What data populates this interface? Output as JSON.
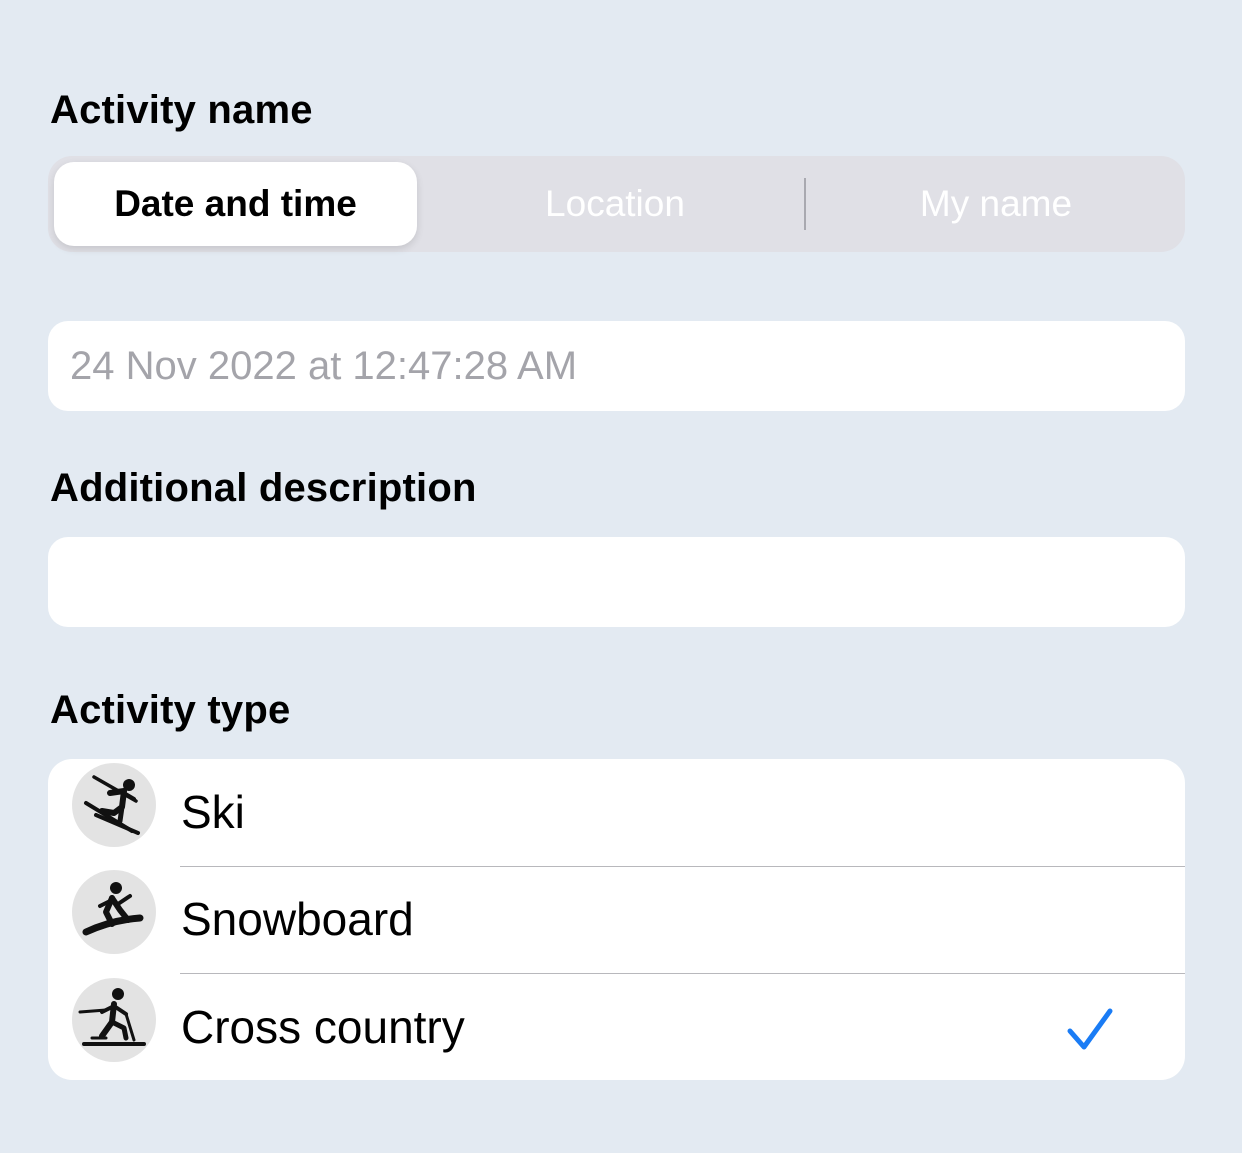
{
  "activity_name": {
    "label": "Activity name",
    "segments": [
      {
        "label": "Date and time",
        "selected": true
      },
      {
        "label": "Location",
        "selected": false
      },
      {
        "label": "My name",
        "selected": false
      }
    ],
    "name_field_placeholder": "24 Nov 2022 at 12:47:28 AM"
  },
  "additional_description": {
    "label": "Additional description",
    "value": ""
  },
  "activity_type": {
    "label": "Activity type",
    "items": [
      {
        "label": "Ski",
        "icon": "skier-icon",
        "checked": false
      },
      {
        "label": "Snowboard",
        "icon": "snowboarder-icon",
        "checked": false
      },
      {
        "label": "Cross country",
        "icon": "cross-country-skier-icon",
        "checked": true
      }
    ]
  },
  "colors": {
    "background": "#e3eaf2",
    "accent": "#1a7cf5",
    "segment_track": "#e0e0e6",
    "placeholder": "#a4a4aa"
  }
}
